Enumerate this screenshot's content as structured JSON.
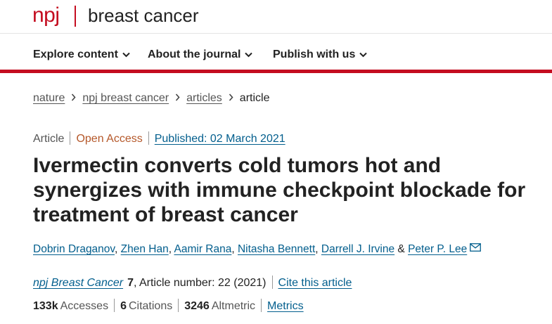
{
  "header": {
    "logo_text": "npj",
    "journal_title": "breast cancer"
  },
  "nav": {
    "items": [
      {
        "label": "Explore content"
      },
      {
        "label": "About the journal"
      },
      {
        "label": "Publish with us"
      }
    ]
  },
  "breadcrumb": {
    "items": [
      "nature",
      "npj breast cancer",
      "articles"
    ],
    "current": "article"
  },
  "article": {
    "type": "Article",
    "access": "Open Access",
    "published": "Published: 02 March 2021",
    "title": "Ivermectin converts cold tumors hot and synergizes with immune checkpoint blockade for treatment of breast cancer",
    "authors": [
      "Dobrin Draganov",
      "Zhen Han",
      "Aamir Rana",
      "Nitasha Bennett",
      "Darrell J. Irvine",
      "Peter P. Lee"
    ],
    "author_conjunction": "&",
    "journal": "npj Breast Cancer",
    "volume": "7",
    "article_number": ", Article number: 22 (2021)",
    "cite_label": "Cite this article"
  },
  "metrics": {
    "accesses_value": "133k",
    "accesses_label": "Accesses",
    "citations_value": "6",
    "citations_label": "Citations",
    "altmetric_value": "3246",
    "altmetric_label": "Altmetric",
    "metrics_link": "Metrics"
  },
  "colors": {
    "brand_red": "#c40d20",
    "link_blue": "#025e8d",
    "open_access": "#b5582a"
  }
}
